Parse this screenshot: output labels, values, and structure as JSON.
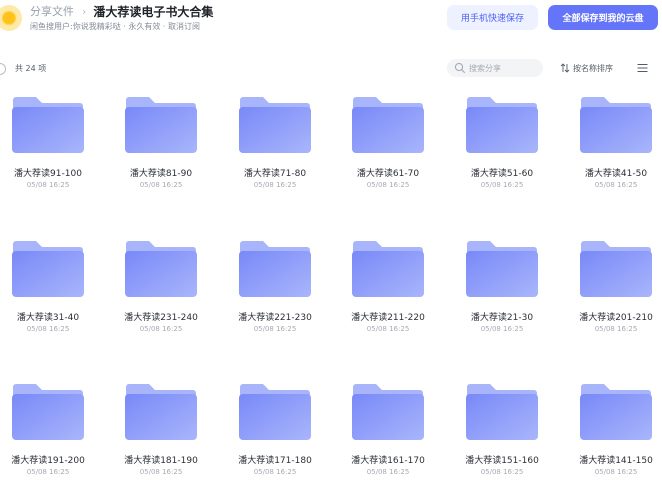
{
  "header": {
    "breadcrumb_root": "分享文件",
    "breadcrumb_separator": "›",
    "title": "潘大荐读电子书大合集",
    "subtitle": "闲鱼搜用户:你说我精彩哒 · 永久有效 · 取消订阅",
    "phone_save_label": "用手机快速保存",
    "save_all_label": "全部保存到我的云盘"
  },
  "toolbar": {
    "count_label": "共 24 项",
    "search_placeholder": "搜索分享",
    "sort_label": "按名称排序"
  },
  "colors": {
    "accent": "#6475f9",
    "folder_light": "#a9b5fb",
    "folder_dark": "#7889f8"
  },
  "files": [
    {
      "name": "潘大荐读91-100",
      "date": "05/08 16:25"
    },
    {
      "name": "潘大荐读81-90",
      "date": "05/08 16:25"
    },
    {
      "name": "潘大荐读71-80",
      "date": "05/08 16:25"
    },
    {
      "name": "潘大荐读61-70",
      "date": "05/08 16:25"
    },
    {
      "name": "潘大荐读51-60",
      "date": "05/08 16:25"
    },
    {
      "name": "潘大荐读41-50",
      "date": "05/08 16:25"
    },
    {
      "name": "潘大荐读31-40",
      "date": "05/08 16:25"
    },
    {
      "name": "潘大荐读231-240",
      "date": "05/08 16:25"
    },
    {
      "name": "潘大荐读221-230",
      "date": "05/08 16:25"
    },
    {
      "name": "潘大荐读211-220",
      "date": "05/08 16:25"
    },
    {
      "name": "潘大荐读21-30",
      "date": "05/08 16:25"
    },
    {
      "name": "潘大荐读201-210",
      "date": "05/08 16:25"
    },
    {
      "name": "潘大荐读191-200",
      "date": "05/08 16:25"
    },
    {
      "name": "潘大荐读181-190",
      "date": "05/08 16:25"
    },
    {
      "name": "潘大荐读171-180",
      "date": "05/08 16:25"
    },
    {
      "name": "潘大荐读161-170",
      "date": "05/08 16:25"
    },
    {
      "name": "潘大荐读151-160",
      "date": "05/08 16:25"
    },
    {
      "name": "潘大荐读141-150",
      "date": "05/08 16:25"
    }
  ]
}
